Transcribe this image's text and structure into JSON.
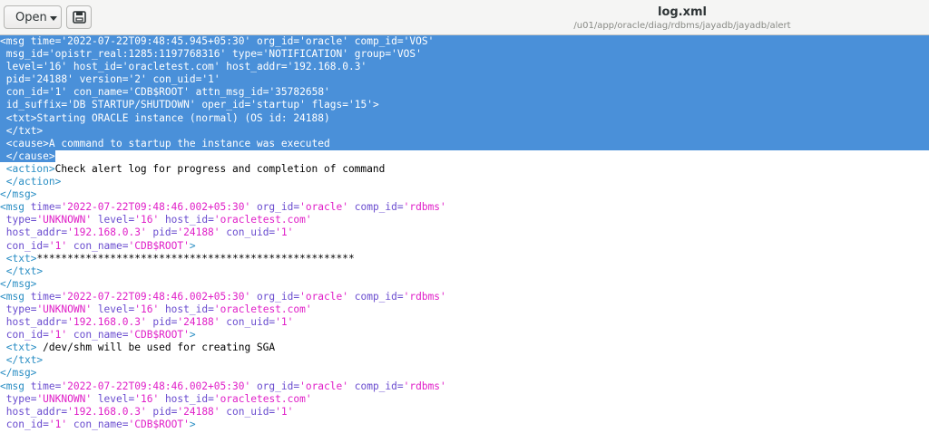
{
  "toolbar": {
    "open_label": "Open",
    "open_dropdown_icon": "chevron-down-icon",
    "save_icon": "save-document-icon"
  },
  "window": {
    "title": "log.xml",
    "path": "/u01/app/oracle/diag/rdbms/jayadb/jayadb/alert"
  },
  "colors": {
    "selection": "#4a90d9",
    "tag": "#2a8ec4",
    "attribute": "#6a4ccf",
    "value": "#e020c8"
  },
  "editor": {
    "lines": [
      {
        "sel": "full",
        "tokens": [
          [
            "tag",
            "<msg "
          ],
          [
            "attr",
            "time="
          ],
          [
            "val",
            "'2022-07-22T09:48:45.945+05:30'"
          ],
          [
            "txt",
            " "
          ],
          [
            "attr",
            "org_id="
          ],
          [
            "val",
            "'oracle'"
          ],
          [
            "txt",
            " "
          ],
          [
            "attr",
            "comp_id="
          ],
          [
            "val",
            "'VOS'"
          ]
        ]
      },
      {
        "sel": "full",
        "tokens": [
          [
            "txt",
            " "
          ],
          [
            "attr",
            "msg_id="
          ],
          [
            "val",
            "'opistr_real:1285:1197768316'"
          ],
          [
            "txt",
            " "
          ],
          [
            "attr",
            "type="
          ],
          [
            "val",
            "'NOTIFICATION'"
          ],
          [
            "txt",
            " "
          ],
          [
            "attr",
            "group="
          ],
          [
            "val",
            "'VOS'"
          ]
        ]
      },
      {
        "sel": "full",
        "tokens": [
          [
            "txt",
            " "
          ],
          [
            "attr",
            "level="
          ],
          [
            "val",
            "'16'"
          ],
          [
            "txt",
            " "
          ],
          [
            "attr",
            "host_id="
          ],
          [
            "val",
            "'oracletest.com'"
          ],
          [
            "txt",
            " "
          ],
          [
            "attr",
            "host_addr="
          ],
          [
            "val",
            "'192.168.0.3'"
          ]
        ]
      },
      {
        "sel": "full",
        "tokens": [
          [
            "txt",
            " "
          ],
          [
            "attr",
            "pid="
          ],
          [
            "val",
            "'24188'"
          ],
          [
            "txt",
            " "
          ],
          [
            "attr",
            "version="
          ],
          [
            "val",
            "'2'"
          ],
          [
            "txt",
            " "
          ],
          [
            "attr",
            "con_uid="
          ],
          [
            "val",
            "'1'"
          ]
        ]
      },
      {
        "sel": "full",
        "tokens": [
          [
            "txt",
            " "
          ],
          [
            "attr",
            "con_id="
          ],
          [
            "val",
            "'1'"
          ],
          [
            "txt",
            " "
          ],
          [
            "attr",
            "con_name="
          ],
          [
            "val",
            "'CDB$ROOT'"
          ],
          [
            "txt",
            " "
          ],
          [
            "attr",
            "attn_msg_id="
          ],
          [
            "val",
            "'35782658'"
          ]
        ]
      },
      {
        "sel": "full",
        "tokens": [
          [
            "txt",
            " "
          ],
          [
            "attr",
            "id_suffix="
          ],
          [
            "val",
            "'DB STARTUP/SHUTDOWN'"
          ],
          [
            "txt",
            " "
          ],
          [
            "attr",
            "oper_id="
          ],
          [
            "val",
            "'startup'"
          ],
          [
            "txt",
            " "
          ],
          [
            "attr",
            "flags="
          ],
          [
            "val",
            "'15'"
          ],
          [
            "tag",
            ">"
          ]
        ]
      },
      {
        "sel": "full",
        "tokens": [
          [
            "txt",
            " "
          ],
          [
            "tag",
            "<txt>"
          ],
          [
            "txt",
            "Starting ORACLE instance (normal) (OS id: 24188)"
          ]
        ]
      },
      {
        "sel": "full",
        "tokens": [
          [
            "txt",
            " "
          ],
          [
            "tag",
            "</txt>"
          ]
        ]
      },
      {
        "sel": "full",
        "tokens": [
          [
            "txt",
            " "
          ],
          [
            "tag",
            "<cause>"
          ],
          [
            "txt",
            "A command to startup the instance was executed"
          ]
        ]
      },
      {
        "sel": "part",
        "tokens": [
          [
            "txt",
            " "
          ],
          [
            "tag",
            "</cause>"
          ]
        ]
      },
      {
        "sel": "none",
        "tokens": [
          [
            "txt",
            " "
          ],
          [
            "tag",
            "<action>"
          ],
          [
            "txt",
            "Check alert log for progress and completion of command"
          ]
        ]
      },
      {
        "sel": "none",
        "tokens": [
          [
            "txt",
            " "
          ],
          [
            "tag",
            "</action>"
          ]
        ]
      },
      {
        "sel": "none",
        "tokens": [
          [
            "tag",
            "</msg>"
          ]
        ]
      },
      {
        "sel": "none",
        "tokens": [
          [
            "tag",
            "<msg "
          ],
          [
            "attr",
            "time="
          ],
          [
            "val",
            "'2022-07-22T09:48:46.002+05:30'"
          ],
          [
            "txt",
            " "
          ],
          [
            "attr",
            "org_id="
          ],
          [
            "val",
            "'oracle'"
          ],
          [
            "txt",
            " "
          ],
          [
            "attr",
            "comp_id="
          ],
          [
            "val",
            "'rdbms'"
          ]
        ]
      },
      {
        "sel": "none",
        "tokens": [
          [
            "txt",
            " "
          ],
          [
            "attr",
            "type="
          ],
          [
            "val",
            "'UNKNOWN'"
          ],
          [
            "txt",
            " "
          ],
          [
            "attr",
            "level="
          ],
          [
            "val",
            "'16'"
          ],
          [
            "txt",
            " "
          ],
          [
            "attr",
            "host_id="
          ],
          [
            "val",
            "'oracletest.com'"
          ]
        ]
      },
      {
        "sel": "none",
        "tokens": [
          [
            "txt",
            " "
          ],
          [
            "attr",
            "host_addr="
          ],
          [
            "val",
            "'192.168.0.3'"
          ],
          [
            "txt",
            " "
          ],
          [
            "attr",
            "pid="
          ],
          [
            "val",
            "'24188'"
          ],
          [
            "txt",
            " "
          ],
          [
            "attr",
            "con_uid="
          ],
          [
            "val",
            "'1'"
          ]
        ]
      },
      {
        "sel": "none",
        "tokens": [
          [
            "txt",
            " "
          ],
          [
            "attr",
            "con_id="
          ],
          [
            "val",
            "'1'"
          ],
          [
            "txt",
            " "
          ],
          [
            "attr",
            "con_name="
          ],
          [
            "val",
            "'CDB$ROOT'"
          ],
          [
            "tag",
            ">"
          ]
        ]
      },
      {
        "sel": "none",
        "tokens": [
          [
            "txt",
            " "
          ],
          [
            "tag",
            "<txt>"
          ],
          [
            "txt",
            "****************************************************"
          ]
        ]
      },
      {
        "sel": "none",
        "tokens": [
          [
            "txt",
            " "
          ],
          [
            "tag",
            "</txt>"
          ]
        ]
      },
      {
        "sel": "none",
        "tokens": [
          [
            "tag",
            "</msg>"
          ]
        ]
      },
      {
        "sel": "none",
        "tokens": [
          [
            "tag",
            "<msg "
          ],
          [
            "attr",
            "time="
          ],
          [
            "val",
            "'2022-07-22T09:48:46.002+05:30'"
          ],
          [
            "txt",
            " "
          ],
          [
            "attr",
            "org_id="
          ],
          [
            "val",
            "'oracle'"
          ],
          [
            "txt",
            " "
          ],
          [
            "attr",
            "comp_id="
          ],
          [
            "val",
            "'rdbms'"
          ]
        ]
      },
      {
        "sel": "none",
        "tokens": [
          [
            "txt",
            " "
          ],
          [
            "attr",
            "type="
          ],
          [
            "val",
            "'UNKNOWN'"
          ],
          [
            "txt",
            " "
          ],
          [
            "attr",
            "level="
          ],
          [
            "val",
            "'16'"
          ],
          [
            "txt",
            " "
          ],
          [
            "attr",
            "host_id="
          ],
          [
            "val",
            "'oracletest.com'"
          ]
        ]
      },
      {
        "sel": "none",
        "tokens": [
          [
            "txt",
            " "
          ],
          [
            "attr",
            "host_addr="
          ],
          [
            "val",
            "'192.168.0.3'"
          ],
          [
            "txt",
            " "
          ],
          [
            "attr",
            "pid="
          ],
          [
            "val",
            "'24188'"
          ],
          [
            "txt",
            " "
          ],
          [
            "attr",
            "con_uid="
          ],
          [
            "val",
            "'1'"
          ]
        ]
      },
      {
        "sel": "none",
        "tokens": [
          [
            "txt",
            " "
          ],
          [
            "attr",
            "con_id="
          ],
          [
            "val",
            "'1'"
          ],
          [
            "txt",
            " "
          ],
          [
            "attr",
            "con_name="
          ],
          [
            "val",
            "'CDB$ROOT'"
          ],
          [
            "tag",
            ">"
          ]
        ]
      },
      {
        "sel": "none",
        "tokens": [
          [
            "txt",
            " "
          ],
          [
            "tag",
            "<txt>"
          ],
          [
            "txt",
            " /dev/shm will be used for creating SGA"
          ]
        ]
      },
      {
        "sel": "none",
        "tokens": [
          [
            "txt",
            " "
          ],
          [
            "tag",
            "</txt>"
          ]
        ]
      },
      {
        "sel": "none",
        "tokens": [
          [
            "tag",
            "</msg>"
          ]
        ]
      },
      {
        "sel": "none",
        "tokens": [
          [
            "tag",
            "<msg "
          ],
          [
            "attr",
            "time="
          ],
          [
            "val",
            "'2022-07-22T09:48:46.002+05:30'"
          ],
          [
            "txt",
            " "
          ],
          [
            "attr",
            "org_id="
          ],
          [
            "val",
            "'oracle'"
          ],
          [
            "txt",
            " "
          ],
          [
            "attr",
            "comp_id="
          ],
          [
            "val",
            "'rdbms'"
          ]
        ]
      },
      {
        "sel": "none",
        "tokens": [
          [
            "txt",
            " "
          ],
          [
            "attr",
            "type="
          ],
          [
            "val",
            "'UNKNOWN'"
          ],
          [
            "txt",
            " "
          ],
          [
            "attr",
            "level="
          ],
          [
            "val",
            "'16'"
          ],
          [
            "txt",
            " "
          ],
          [
            "attr",
            "host_id="
          ],
          [
            "val",
            "'oracletest.com'"
          ]
        ]
      },
      {
        "sel": "none",
        "tokens": [
          [
            "txt",
            " "
          ],
          [
            "attr",
            "host_addr="
          ],
          [
            "val",
            "'192.168.0.3'"
          ],
          [
            "txt",
            " "
          ],
          [
            "attr",
            "pid="
          ],
          [
            "val",
            "'24188'"
          ],
          [
            "txt",
            " "
          ],
          [
            "attr",
            "con_uid="
          ],
          [
            "val",
            "'1'"
          ]
        ]
      },
      {
        "sel": "none",
        "tokens": [
          [
            "txt",
            " "
          ],
          [
            "attr",
            "con_id="
          ],
          [
            "val",
            "'1'"
          ],
          [
            "txt",
            " "
          ],
          [
            "attr",
            "con_name="
          ],
          [
            "val",
            "'CDB$ROOT'"
          ],
          [
            "tag",
            ">"
          ]
        ]
      }
    ]
  }
}
